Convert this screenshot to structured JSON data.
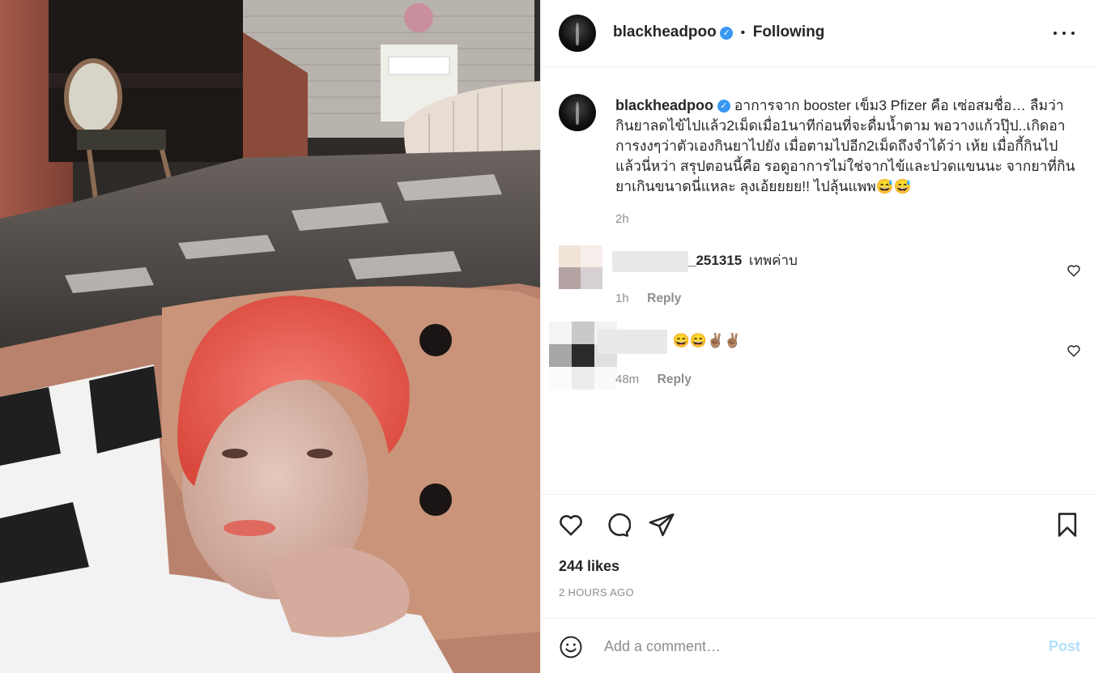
{
  "post": {
    "image": {
      "description_icon": "selfie-photo"
    },
    "author": {
      "username": "blackheadpoo",
      "verified": true,
      "verified_icon": "verified-badge-icon",
      "separator": "•",
      "follow_status": "Following"
    },
    "more_icon": "more-options-icon",
    "caption": {
      "username": "blackheadpoo",
      "text": "อาการจาก booster เข็ม3 Pfizer คือ เซ่อสมชื่อ… ลืมว่ากินยาลดไข้ไปแล้ว2เม็ดเมื่อ1นาทีก่อนที่จะดื่มน้ำตาม พอวางแก้วปุ๊ป..เกิดอาการงงๆว่าตัวเองกินยาไปยัง เมื่อตามไปอีก2เม็ดถึงจำได้ว่า เห้ย เมื่อกี้กินไปแล้วนี่หว่า สรุปตอนนี้คือ รอดูอาการไม่ใช่จากไข้และปวดแขนนะ จากยาที่กินยาเกินขนาดนี่แหละ ลุงเอ้ยยยย!! ไปลุ้นแพพ😅😅",
      "time": "2h"
    },
    "comments": [
      {
        "username_visible": "_251315",
        "text": "เทพค่าบ",
        "time": "1h",
        "reply_label": "Reply"
      },
      {
        "username_visible": "",
        "text": "😄😄✌🏽✌🏽",
        "time": "48m",
        "reply_label": "Reply"
      }
    ],
    "likes": "244 likes",
    "posted_ago": "2 HOURS AGO",
    "add_comment": {
      "placeholder": "Add a comment…",
      "post_label": "Post",
      "emoji_icon": "emoji-smile-icon"
    },
    "action_icons": [
      "heart-icon",
      "comment-bubble-icon",
      "share-paper-plane-icon",
      "bookmark-icon"
    ]
  },
  "colors": {
    "verified": "#3897f0",
    "post_disabled": "#b2dffc",
    "muted": "#8e8e8e",
    "text": "#262626",
    "hair": "#e8584c"
  }
}
